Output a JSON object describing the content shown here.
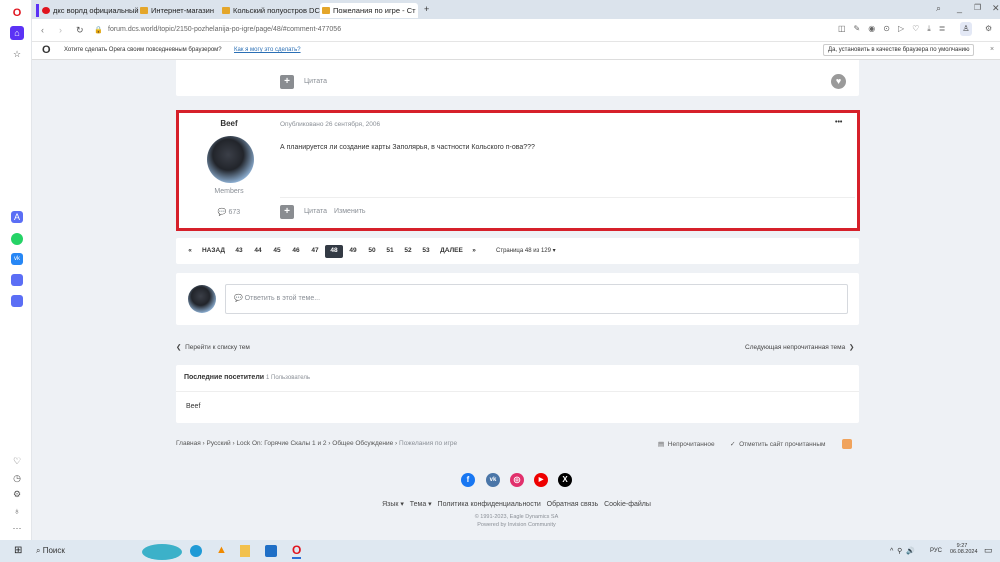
{
  "browser": {
    "tabs": [
      "дкс ворлд официальный",
      "Интернет-магазин",
      "Кольский полуостров DC",
      "Пожелания по игре - Ст"
    ],
    "url": "forum.dcs.world/topic/2150-pozhelanija-po-igre/page/48/#comment-477056",
    "infobar": {
      "text": "Хотите сделать Opera своим повседневным браузером?",
      "link": "Как я могу это сделать?",
      "button": "Да, установить в качестве браузера по умолчанию"
    }
  },
  "prev_post": {
    "quote": "Цитата"
  },
  "post": {
    "author": "Beef",
    "group": "Members",
    "post_count": "673",
    "date": "Опубликовано 26 сентября, 2006",
    "body": "А планируется ли создание карты Заполярья, в частности Кольского п-ова???",
    "quote": "Цитата",
    "edit": "Изменить",
    "menu": "•••"
  },
  "pagination": {
    "prev": "НАЗАД",
    "next": "ДАЛЕЕ",
    "pages": [
      "43",
      "44",
      "45",
      "46",
      "47",
      "48",
      "49",
      "50",
      "51",
      "52",
      "53"
    ],
    "current": "48",
    "summary": "Страница 48 из 129"
  },
  "reply": {
    "placeholder": "Ответить в этой теме..."
  },
  "nav": {
    "back": "Перейти к списку тем",
    "next": "Следующая непрочитанная тема"
  },
  "visitors": {
    "title": "Последние посетители",
    "count": "1 Пользователь",
    "users": [
      "Beef"
    ]
  },
  "breadcrumb": [
    "Главная",
    "Русский",
    "Lock On: Горячие Скалы 1 и 2",
    "Общее Обсуждение",
    "Пожелания по игре"
  ],
  "breadcrumb_actions": {
    "unread": "Непрочитанное",
    "mark_read": "Отметить сайт прочитанным"
  },
  "footer": {
    "links": [
      "Язык ▾",
      "Тема ▾",
      "Политика конфиденциальности",
      "Обратная связь",
      "Cookie-файлы"
    ],
    "copyright": "© 1991-2023, Eagle Dynamics SA",
    "powered": "Powered by Invision Community"
  },
  "taskbar": {
    "search": "Поиск",
    "lang": "РУС",
    "time": "9:27",
    "date": "06.08.2024"
  },
  "colors": {
    "highlight": "#d6202a",
    "accent": "#5b32f5"
  }
}
